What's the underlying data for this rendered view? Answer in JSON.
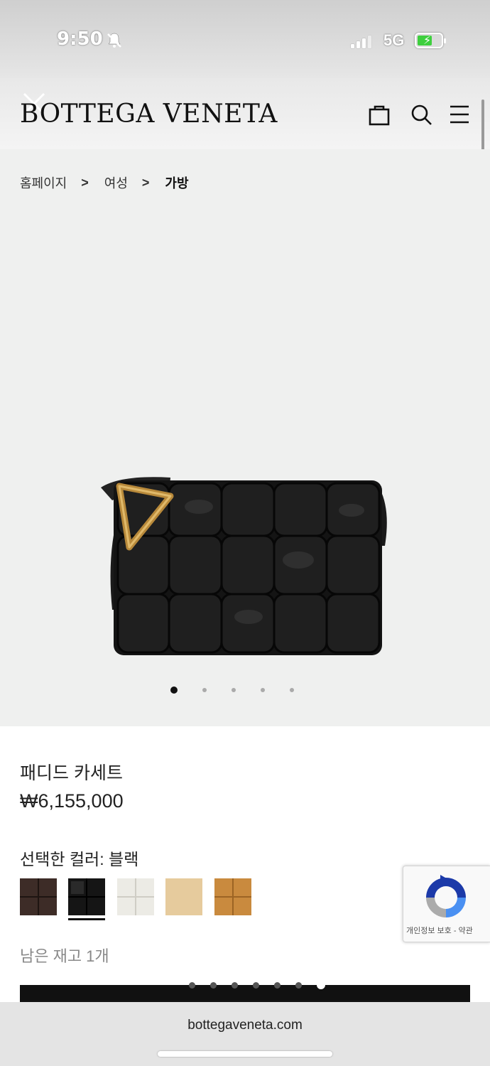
{
  "status": {
    "time": "9:50",
    "network": "5G"
  },
  "header": {
    "brand": "BOTTEGA VENETA"
  },
  "breadcrumb": {
    "home": "홈페이지",
    "sep": ">",
    "women": "여성",
    "bags": "가방"
  },
  "gallery": {
    "count": 5,
    "active_index": 0
  },
  "product": {
    "name": "패디드 카세트",
    "price": "₩6,155,000",
    "selected_color_label": "선택한 컬러: 블랙",
    "swatches": [
      {
        "name": "fondant",
        "color": "#3d2c27"
      },
      {
        "name": "black",
        "color": "#151515"
      },
      {
        "name": "white",
        "color": "#ecebe5"
      },
      {
        "name": "beige",
        "color": "#e6cb9d"
      },
      {
        "name": "caramel",
        "color": "#c98a3e"
      }
    ],
    "selected_index": 1,
    "stock": "남은 재고 1개"
  },
  "recaptcha": {
    "text": "개인정보 보호 - 약관"
  },
  "browser": {
    "url": "bottegaveneta.com"
  }
}
